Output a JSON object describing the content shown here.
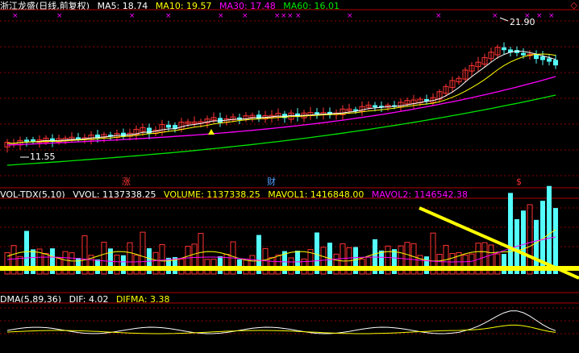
{
  "header": {
    "title": "浙江龙盛(日线,前复权)",
    "ma5": "MA5: 18.74",
    "ma10": "MA10: 19.57",
    "ma30": "MA30: 17.48",
    "ma60": "MA60: 16.01",
    "corner_icon": "◇"
  },
  "price_labels": {
    "high": "21.90",
    "low": "11.55"
  },
  "markers": {
    "m1": "涨",
    "m2": "财",
    "m3": "$"
  },
  "volume": {
    "name": "VOL-TDX(5,10)",
    "vvol": "VVOL: 1137338.25",
    "volume": "VOLUME: 1137338.25",
    "mavol1": "MAVOL1: 1416848.00",
    "mavol2": "MAVOL2: 1146542.38"
  },
  "dma": {
    "name": "DMA(5,89,36)",
    "dif": "DIF: 4.02",
    "difma": "DIFMA: 3.38"
  },
  "colors": {
    "up": "#ff3333",
    "down": "#54fcfc",
    "ma5": "#ffffff",
    "ma10": "#ffff00",
    "ma30": "#ff00ff",
    "ma60": "#00e600",
    "grid": "#8b0000",
    "annotation": "#ffff00"
  },
  "chart_data": {
    "type": "candlestick",
    "note_series": [
      "MA5",
      "MA10",
      "MA30",
      "MA60"
    ],
    "price_range_visible": [
      11.55,
      21.9
    ]
  }
}
